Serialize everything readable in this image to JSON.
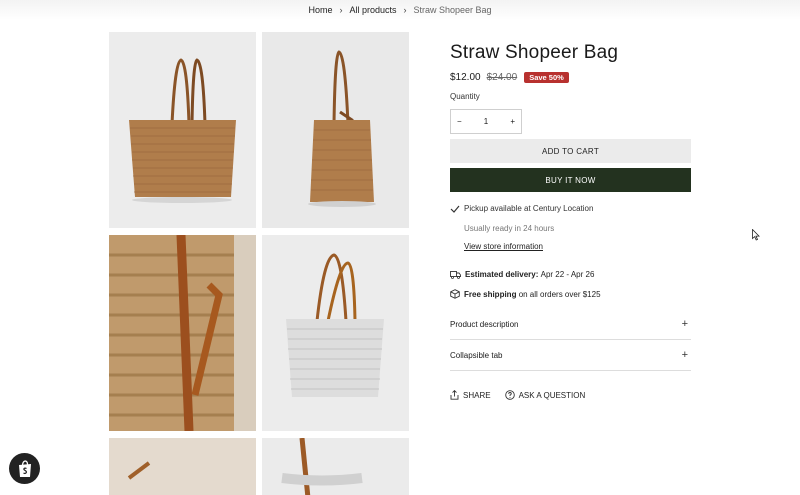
{
  "breadcrumb": {
    "home": "Home",
    "all_products": "All products",
    "separator": "›",
    "current": "Straw Shopeer Bag"
  },
  "product": {
    "title": "Straw Shopeer Bag",
    "price": "$12.00",
    "compare_price": "$24.00",
    "badge": "Save 50%",
    "quantity_label": "Quantity",
    "quantity_value": "1",
    "qty_minus": "−",
    "qty_plus": "+"
  },
  "buttons": {
    "add_to_cart": "ADD TO CART",
    "buy_now": "BUY IT NOW"
  },
  "pickup": {
    "available_text": "Pickup available at Century Location",
    "ready_text": "Usually ready in 24 hours",
    "store_link": "View store information"
  },
  "delivery": {
    "label": "Estimated delivery:",
    "value": "Apr 22 - Apr 26"
  },
  "shipping": {
    "label": "Free shipping",
    "value": "on all orders over $125"
  },
  "accordions": [
    {
      "label": "Product description",
      "icon": "+"
    },
    {
      "label": "Collapsible tab",
      "icon": "+"
    }
  ],
  "actions": {
    "share": "SHARE",
    "ask": "ASK A QUESTION"
  },
  "colors": {
    "buy_button": "#23321f",
    "badge": "#b8312f",
    "add_button": "#ebebeb"
  },
  "icons": [
    "check-icon",
    "truck-icon",
    "box-icon",
    "share-icon",
    "question-icon",
    "shopify-bag-icon",
    "mouse-cursor-icon"
  ]
}
